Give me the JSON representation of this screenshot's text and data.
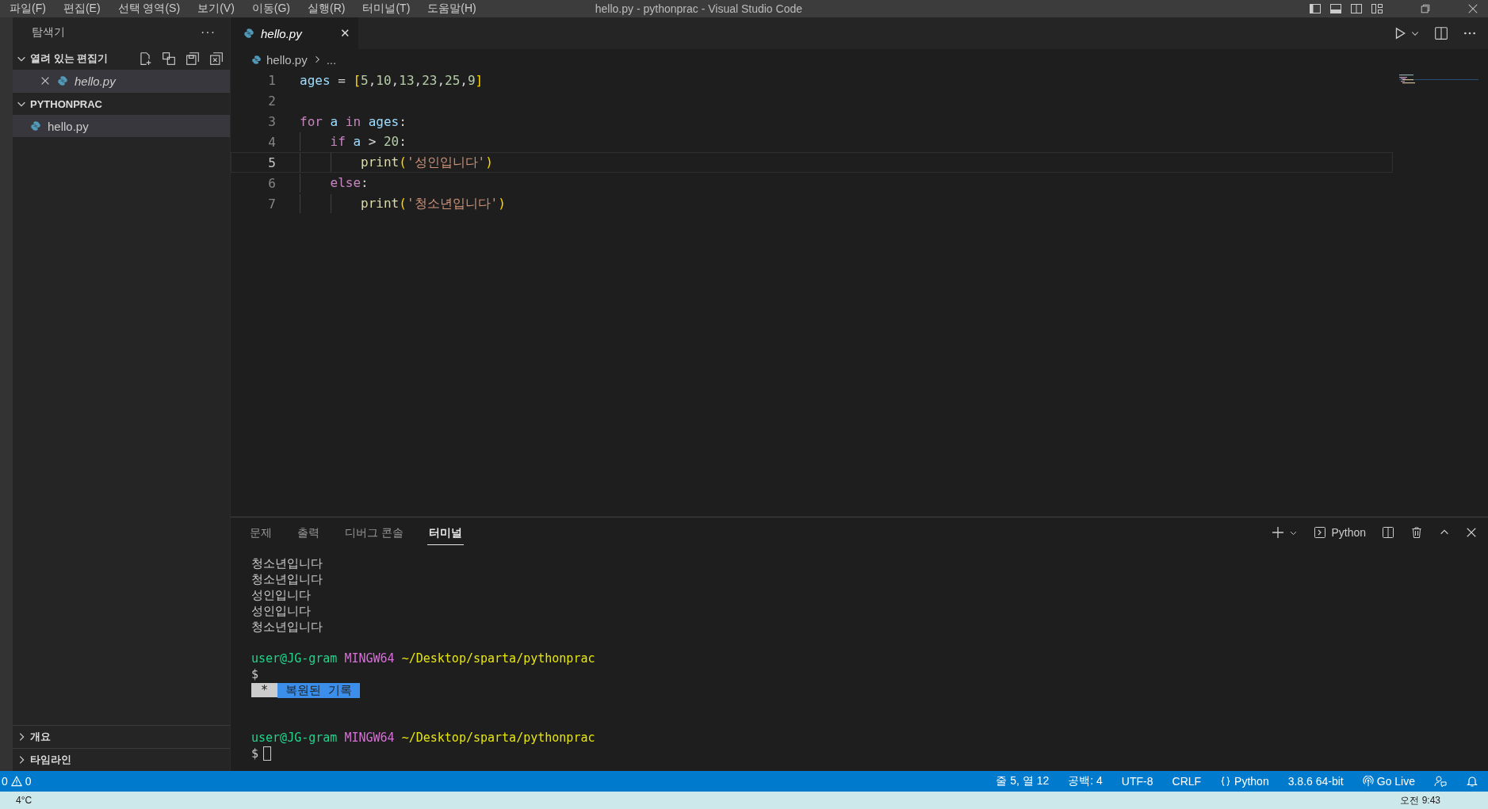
{
  "menu_bar": {
    "items": [
      "파일(F)",
      "편집(E)",
      "선택 영역(S)",
      "보기(V)",
      "이동(G)",
      "실행(R)",
      "터미널(T)",
      "도움말(H)"
    ],
    "title": "hello.py - pythonprac - Visual Studio Code"
  },
  "sidebar": {
    "title": "탐색기",
    "more": "···",
    "sections": [
      {
        "title": "열려 있는 편집기",
        "expanded": true,
        "has_actions": true,
        "items": [
          {
            "name": "hello.py",
            "italic": true,
            "closable": true,
            "selected": true
          }
        ]
      },
      {
        "title": "PYTHONPRAC",
        "expanded": true,
        "has_actions": false,
        "items": [
          {
            "name": "hello.py",
            "italic": false,
            "closable": false,
            "selected": true
          }
        ]
      }
    ],
    "bottom_sections": [
      {
        "title": "개요",
        "expanded": false
      },
      {
        "title": "타임라인",
        "expanded": false
      }
    ]
  },
  "tabs": [
    {
      "label": "hello.py",
      "selected": true,
      "close": "✕"
    }
  ],
  "breadcrumb": {
    "file": "hello.py",
    "rest": "..."
  },
  "code": [
    {
      "number": "1",
      "current": false,
      "tokens": [
        {
          "kind": "var",
          "text": "ages",
          "space_after": true
        },
        {
          "kind": "plain",
          "text": "=",
          "space_after": true
        },
        {
          "kind": "bracket",
          "text": "["
        },
        {
          "kind": "num",
          "text": "5"
        },
        {
          "kind": "plain",
          "text": ","
        },
        {
          "kind": "num",
          "text": "10"
        },
        {
          "kind": "plain",
          "text": ","
        },
        {
          "kind": "num",
          "text": "13"
        },
        {
          "kind": "plain",
          "text": ","
        },
        {
          "kind": "num",
          "text": "23"
        },
        {
          "kind": "plain",
          "text": ","
        },
        {
          "kind": "num",
          "text": "25"
        },
        {
          "kind": "plain",
          "text": ","
        },
        {
          "kind": "num",
          "text": "9"
        },
        {
          "kind": "bracket",
          "text": "]"
        }
      ]
    },
    {
      "number": "2",
      "current": false
    },
    {
      "number": "3",
      "current": false,
      "tokens": [
        {
          "kind": "keyword",
          "text": "for",
          "space_after": true
        },
        {
          "kind": "var",
          "text": "a",
          "space_after": true
        },
        {
          "kind": "keyword",
          "text": "in",
          "space_after": true
        },
        {
          "kind": "var",
          "text": "ages"
        },
        {
          "kind": "plain",
          "text": ":"
        }
      ]
    },
    {
      "number": "4",
      "current": false,
      "tokens": [
        {
          "kind": "indent"
        },
        {
          "kind": "keyword",
          "text": "if",
          "space_after": true
        },
        {
          "kind": "var",
          "text": "a",
          "space_after": true
        },
        {
          "kind": "plain",
          "text": ">",
          "space_after": true
        },
        {
          "kind": "num",
          "text": "20"
        },
        {
          "kind": "plain",
          "text": ":"
        }
      ]
    },
    {
      "number": "5",
      "current": true,
      "tokens": [
        {
          "kind": "indent"
        },
        {
          "kind": "indent"
        },
        {
          "kind": "func",
          "text": "print"
        },
        {
          "kind": "bracket",
          "text": "("
        },
        {
          "kind": "string",
          "text": "'성인입니다'"
        },
        {
          "kind": "bracket",
          "text": ")"
        }
      ]
    },
    {
      "number": "6",
      "current": false,
      "tokens": [
        {
          "kind": "indent"
        },
        {
          "kind": "keyword",
          "text": "else"
        },
        {
          "kind": "plain",
          "text": ":"
        }
      ]
    },
    {
      "number": "7",
      "current": false,
      "tokens": [
        {
          "kind": "indent"
        },
        {
          "kind": "indent"
        },
        {
          "kind": "func",
          "text": "print"
        },
        {
          "kind": "bracket",
          "text": "("
        },
        {
          "kind": "string",
          "text": "'청소년입니다'"
        },
        {
          "kind": "bracket",
          "text": ")"
        }
      ]
    }
  ],
  "panel": {
    "tabs": [
      {
        "label": "문제",
        "selected": false
      },
      {
        "label": "출력",
        "selected": false
      },
      {
        "label": "디버그 콘솔",
        "selected": false
      },
      {
        "label": "터미널",
        "selected": true
      }
    ],
    "shell": "Python",
    "terminal": [
      {
        "kind": "output",
        "text": "청소년입니다"
      },
      {
        "kind": "output",
        "text": "청소년입니다"
      },
      {
        "kind": "output",
        "text": "성인입니다"
      },
      {
        "kind": "output",
        "text": "성인입니다"
      },
      {
        "kind": "output",
        "text": "청소년입니다"
      },
      {
        "kind": "blank"
      },
      {
        "kind": "prompt",
        "user": "user@JG-gram",
        "host": "MINGW64",
        "path": "~/Desktop/sparta/pythonprac"
      },
      {
        "kind": "dollar",
        "text": "$",
        "cursor": false
      },
      {
        "kind": "restored",
        "mark": "*",
        "text": "복원된 기록"
      },
      {
        "kind": "blank"
      },
      {
        "kind": "blank"
      },
      {
        "kind": "prompt",
        "user": "user@JG-gram",
        "host": "MINGW64",
        "path": "~/Desktop/sparta/pythonprac"
      },
      {
        "kind": "dollar",
        "text": "$",
        "cursor": true
      }
    ]
  },
  "status_bar": {
    "errors": "0",
    "warnings": "0",
    "items": [
      {
        "kind": "text",
        "text": "줄 5, 열 12"
      },
      {
        "kind": "text",
        "text": "공백: 4"
      },
      {
        "kind": "text",
        "text": "UTF-8"
      },
      {
        "kind": "text",
        "text": "CRLF"
      },
      {
        "kind": "braces",
        "text": "Python"
      },
      {
        "kind": "text",
        "text": "3.8.6 64-bit"
      },
      {
        "kind": "live",
        "text": "Go Live"
      },
      {
        "kind": "feedback"
      },
      {
        "kind": "bell"
      }
    ]
  },
  "taskbar": {
    "weather": "4°C",
    "time": "오전 9:43"
  }
}
